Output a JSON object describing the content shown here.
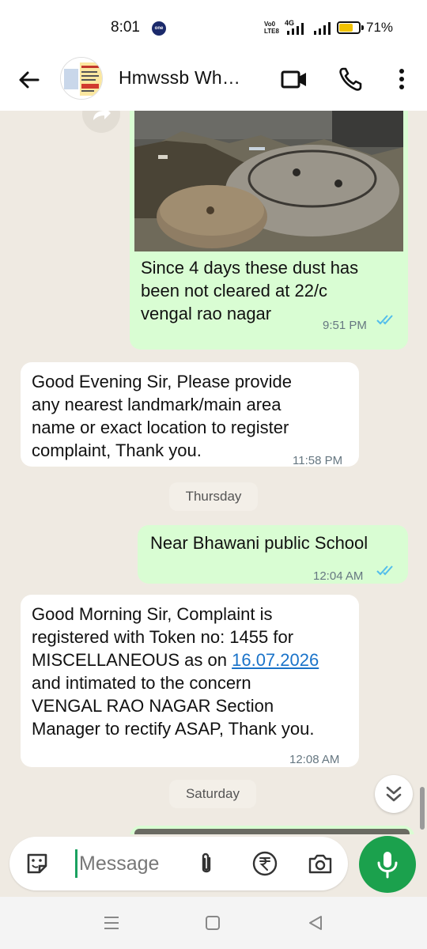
{
  "status_bar": {
    "time": "8:01",
    "network_label_top": "Vo0",
    "network_label_bottom": "LTE8",
    "network_type": "4G",
    "battery_percent": "71%",
    "battery_level": 0.71
  },
  "header": {
    "contact_name": "Hmwssb Wh…",
    "icons": [
      "back-arrow-icon",
      "video-call-icon",
      "phone-call-icon",
      "more-options-icon"
    ]
  },
  "messages": [
    {
      "direction": "outgoing",
      "has_image": true,
      "text": "Since 4 days these dust has\nbeen not cleared at 22/c\nvengal rao nagar",
      "time": "9:51 PM",
      "status": "read"
    },
    {
      "direction": "incoming",
      "text": "Good Evening Sir, Please provide\nany nearest landmark/main area\nname or exact location to register\ncomplaint, Thank you.",
      "time": "11:58 PM"
    },
    {
      "type": "date_divider",
      "label": "Thursday"
    },
    {
      "direction": "outgoing",
      "text": "Near Bhawani public School",
      "time": "12:04 AM",
      "status": "read"
    },
    {
      "direction": "incoming",
      "text_before_link": "Good Morning Sir, Complaint is\nregistered with Token no: 1455 for\nMISCELLANEOUS as on ",
      "link_text": "16.07.2026",
      "text_after_link": "\nand intimated to the concern\nVENGAL RAO NAGAR Section\nManager to rectify ASAP, Thank you.",
      "time": "12:08 AM"
    },
    {
      "type": "date_divider",
      "label": "Saturday"
    }
  ],
  "composer": {
    "placeholder": "Message",
    "icons": [
      "sticker-icon",
      "attach-icon",
      "rupee-payment-icon",
      "camera-icon",
      "mic-icon"
    ]
  },
  "colors": {
    "outgoing_bubble": "#d9fdd3",
    "incoming_bubble": "#ffffff",
    "chat_background": "#efeae2",
    "read_ticks": "#53bdeb",
    "link": "#1a73c9",
    "mic_button": "#1ba14d"
  }
}
